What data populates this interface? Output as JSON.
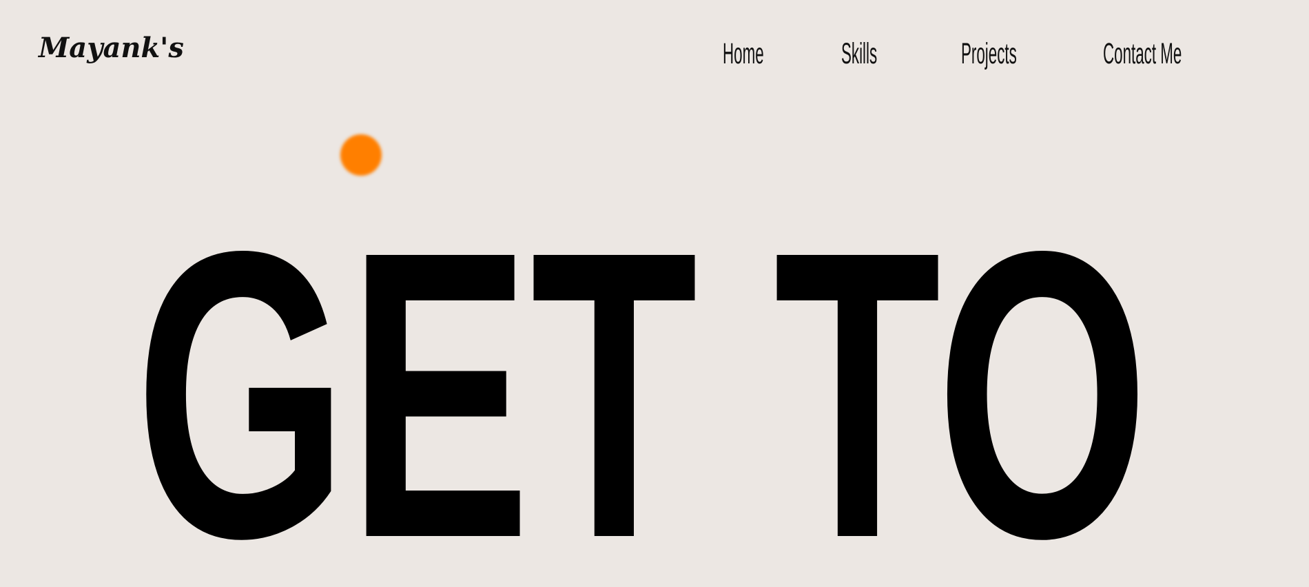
{
  "header": {
    "logo_text": "Mayank's"
  },
  "nav": {
    "items": [
      {
        "label": "Home"
      },
      {
        "label": "Skills"
      },
      {
        "label": "Projects"
      },
      {
        "label": "Contact Me"
      }
    ]
  },
  "hero": {
    "headline": "GET TO",
    "accent_color": "#ff7f00"
  },
  "theme": {
    "background": "#ece7e3",
    "text_color": "#000000"
  }
}
